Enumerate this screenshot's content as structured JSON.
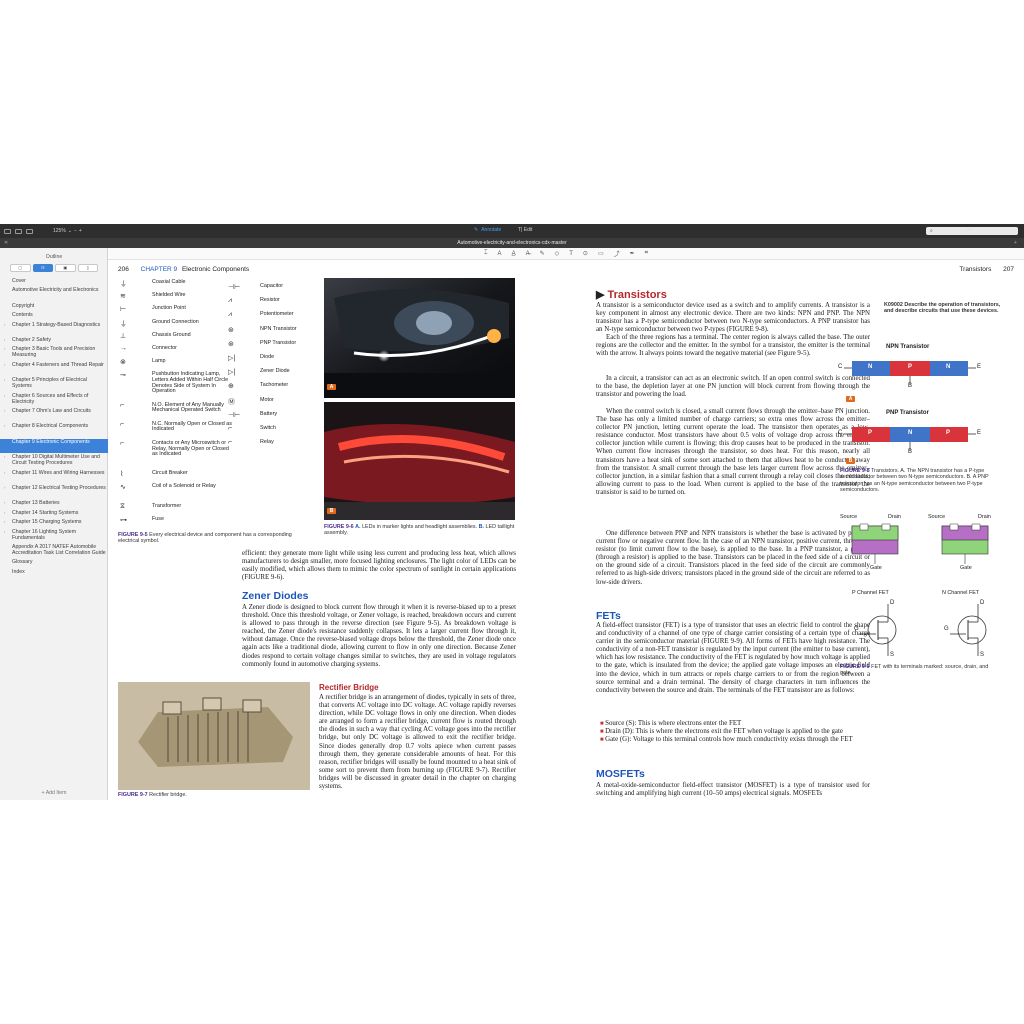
{
  "toolbar": {
    "zoom": "125%",
    "annotate": "Annotate",
    "edit": "Edit",
    "zoom_chevron": "⌄",
    "minus": "−",
    "plus": "+"
  },
  "title": "Automotive-electricity-and-electronics-cdx-master",
  "sidebar": {
    "title": "Outline",
    "toc": [
      {
        "label": "Cover",
        "caret": false,
        "sel": false
      },
      {
        "label": "Automotive Electricity and Electronics",
        "caret": false,
        "sel": false
      },
      {
        "label": "Copyright",
        "caret": false,
        "sel": false
      },
      {
        "label": "Contents",
        "caret": false,
        "sel": false
      },
      {
        "label": "Chapter 1 Strategy-Based Diagnostics",
        "caret": true,
        "sel": false
      },
      {
        "label": "Chapter 2 Safety",
        "caret": true,
        "sel": false
      },
      {
        "label": "Chapter 3 Basic Tools and Precision Measuring",
        "caret": true,
        "sel": false
      },
      {
        "label": "Chapter 4 Fasteners and Thread Repair",
        "caret": true,
        "sel": false
      },
      {
        "label": "Chapter 5 Principles of Electrical Systems",
        "caret": true,
        "sel": false
      },
      {
        "label": "Chapter 6 Sources and Effects of Electricity",
        "caret": true,
        "sel": false
      },
      {
        "label": "Chapter 7 Ohm's Law and Circuits",
        "caret": true,
        "sel": false
      },
      {
        "label": "Chapter 8 Electrical Components",
        "caret": true,
        "sel": false
      },
      {
        "label": "Chapter 9 Electronic Components",
        "caret": true,
        "sel": true
      },
      {
        "label": "Chapter 10 Digital Multimeter Use and Circuit Testing Procedures",
        "caret": true,
        "sel": false
      },
      {
        "label": "Chapter 11 Wires and Wiring Harnesses",
        "caret": true,
        "sel": false
      },
      {
        "label": "Chapter 12 Electrical Testing Procedures",
        "caret": true,
        "sel": false
      },
      {
        "label": "Chapter 13 Batteries",
        "caret": true,
        "sel": false
      },
      {
        "label": "Chapter 14 Starting Systems",
        "caret": true,
        "sel": false
      },
      {
        "label": "Chapter 15 Charging Systems",
        "caret": true,
        "sel": false
      },
      {
        "label": "Chapter 16 Lighting System Fundamentals",
        "caret": true,
        "sel": false
      },
      {
        "label": "Appendix A 2017 NATEF Automobile Accreditation Task List Correlation Guide",
        "caret": false,
        "sel": false
      },
      {
        "label": "Glossary",
        "caret": false,
        "sel": false
      },
      {
        "label": "Index",
        "caret": false,
        "sel": false
      }
    ],
    "add_item": "+ Add Item"
  },
  "page206": {
    "number": "206",
    "chapter": "CHAPTER 9",
    "chapter_title": "Electronic Components",
    "symbols_left": [
      {
        "icon": "⏚",
        "label": "Coaxial Cable"
      },
      {
        "icon": "≋",
        "label": "Shielded Wire"
      },
      {
        "icon": "⊢",
        "label": "Junction Point"
      },
      {
        "icon": "⏚",
        "label": "Ground Connection"
      },
      {
        "icon": "⊥",
        "label": "Chassis Ground"
      },
      {
        "icon": "→",
        "label": "Connector"
      },
      {
        "icon": "⊗",
        "label": "Lamp"
      },
      {
        "icon": "⊸",
        "label": "Pushbutton Indicating Lamp, Letters Added Within Half Circle Denotes Side of System In Operation"
      },
      {
        "icon": "⌐",
        "label": "N.O. Element of Any Manually Mechanical Operated Switch"
      },
      {
        "icon": "⌐",
        "label": "N.C. Normally Open or Closed as Indicated"
      },
      {
        "icon": "⌐",
        "label": "Contacts or Any Microswitch or Relay, Normally Open or Closed as Indicated"
      },
      {
        "icon": "⌇",
        "label": "Circuit Breaker"
      },
      {
        "icon": "∿",
        "label": "Coil of a Solenoid or Relay"
      },
      {
        "icon": "⧖",
        "label": "Transformer"
      },
      {
        "icon": "⊶",
        "label": "Fuse"
      }
    ],
    "symbols_right": [
      {
        "icon": "⊣⊢",
        "label": "Capacitor"
      },
      {
        "icon": "⩘",
        "label": "Resistor"
      },
      {
        "icon": "⩘",
        "label": "Potentiometer"
      },
      {
        "icon": "⊛",
        "label": "NPN Transistor"
      },
      {
        "icon": "⊛",
        "label": "PNP Transistor"
      },
      {
        "icon": "▷|",
        "label": "Diode"
      },
      {
        "icon": "▷|",
        "label": "Zener Diode"
      },
      {
        "icon": "⊕",
        "label": "Tachometer"
      },
      {
        "icon": "Ⓜ",
        "label": "Motor"
      },
      {
        "icon": "⊣⊢",
        "label": "Battery"
      },
      {
        "icon": "⌐",
        "label": "Switch"
      },
      {
        "icon": "⌐",
        "label": "Relay"
      }
    ],
    "fig95_label": "FIGURE 9-5",
    "fig95_caption": "Every electrical device and component has a corresponding electrical symbol.",
    "fig96_label": "FIGURE 9-6",
    "fig96_caption_a": "A.",
    "fig96_caption_a_text": "LEDs in marker lights and headlight assemblies.",
    "fig96_caption_b": "B.",
    "fig96_caption_b_text": "LED taillight assembly.",
    "badge_a": "A",
    "badge_b": "B",
    "para_efficient": "efficient: they generate more light while using less current and producing less heat, which allows manufacturers to design smaller, more focused lighting enclosures. The light color of LEDs can be easily modified, which allows them to mimic the color spectrum of sunlight in certain applications (FIGURE 9-6).",
    "zener_heading": "Zener Diodes",
    "zener_text": "A Zener diode is designed to block current flow through it when it is reverse-biased up to a preset threshold. Once this threshold voltage, or Zener voltage, is reached, breakdown occurs and current is allowed to pass through in the reverse direction (see Figure 9-5). As breakdown voltage is reached, the Zener diode's resistance suddenly collapses. It lets a larger current flow through it, without damage. Once the reverse-biased voltage drops below the threshold, the Zener diode once again acts like a traditional diode, allowing current to flow in only one direction. Because Zener diodes respond to certain voltage changes similar to switches, they are used in voltage regulators commonly found in automotive charging systems.",
    "rect_heading": "Rectifier Bridge",
    "rect_text": "A rectifier bridge is an arrangement of diodes, typically in sets of three, that converts AC voltage into DC voltage. AC voltage rapidly reverses direction, while DC voltage flows in only one direction. When diodes are arranged to form a rectifier bridge, current flow is routed through the diodes in such a way that cycling AC voltage goes into the rectifier bridge, but only DC voltage is allowed to exit the rectifier bridge. Since diodes generally drop 0.7 volts apiece when current passes through them, they generate considerable amounts of heat. For this reason, rectifier bridges will usually be found mounted to a heat sink of some sort to prevent them from burning up (FIGURE 9-7). Rectifier bridges will be discussed in greater detail in the chapter on charging systems.",
    "fig97_label": "FIGURE 9-7",
    "fig97_caption": "Rectifier bridge."
  },
  "page207": {
    "number": "207",
    "running_title": "Transistors",
    "transistors_heading": "Transistors",
    "objective_code": "K09002",
    "objective_text": "Describe the operation of transistors, and describe circuits that use these devices.",
    "p1": "A transistor is a semiconductor device used as a switch and to amplify currents. A transistor is a key component in almost any electronic device. There are two kinds: NPN and PNP. The NPN transistor has a P-type semiconductor between two N-type semiconductors. A PNP transistor has an N-type semiconductor between two P-types (FIGURE 9-8).",
    "p2": "Each of the three regions has a terminal. The center region is always called the base. The outer regions are the collector and the emitter. In the symbol for a transistor, the emitter is the terminal with the arrow. It always points toward the negative material (see Figure 9-5).",
    "p3": "In a circuit, a transistor can act as an electronic switch. If an open control switch is connected to the base, the depletion layer at one PN junction will block current from flowing through the transistor and powering the load.",
    "p4": "When the control switch is closed, a small current flows through the emitter–base PN junction. The base has only a limited number of charge carriers; so extra ones flow across the emitter–collector PN junction, letting current operate the load. The transistor then operates as a low-resistance conductor. Most transistors have about 0.5 volts of voltage drop across the emitter–collector junction while current is flowing; this drop causes heat to be produced in the transistor. When current flow increases through the transistor, so does heat. For this reason, nearly all transistors have a heat sink of some sort attached to them that allows heat to be conducted away from the transistor. A small current through the base lets larger current flow across the emitter–collector junction, in a similar fashion that a small current through a relay coil closes the contacts, allowing current to pass to the load. When current is applied to the base of the transistor, the transistor is said to be turned on.",
    "p5": "One difference between PNP and NPN transistors is whether the base is activated by positive current flow or negative current flow. In the case of an NPN transistor, positive current, through a resistor (to limit current flow to the base), is applied to the base. In a PNP transistor, a ground (through a resistor) is applied to the base. Transistors can be placed in the feed side of a circuit or on the ground side of a circuit. Transistors placed in the feed side of the circuit are commonly referred to as high-side drivers; transistors placed in the ground side of the circuit are referred to as low-side drivers.",
    "fets_heading": "FETs",
    "fets_text": "A field-effect transistor (FET) is a type of transistor that uses an electric field to control the shape and conductivity of a channel of one type of charge carrier consisting of a certain type of charge carrier in the semiconductor material (FIGURE 9-9). All forms of FETs have high resistance. The conductivity of a non-FET transistor is regulated by the input current (the emitter to base current), which has low resistance. The conductivity of the FET is regulated by how much voltage is applied to the gate, which is insulated from the device; the applied gate voltage imposes an electric field into the device, which in turn attracts or repels charge carriers to or from the region between a source terminal and a drain terminal. The density of charge characters in turn influences the conductivity between the source and drain. The terminals of the FET transistor are as follows:",
    "bullets": [
      "Source (S): This is where electrons enter the FET",
      "Drain (D): This is where the electrons exit the FET when voltage is applied to the gate",
      "Gate (G): Voltage to this terminal controls how much conductivity exists through the FET"
    ],
    "mosfets_heading": "MOSFETs",
    "mosfets_text": "A metal-oxide-semiconductor field-effect transistor (MOSFET) is a type of transistor used for switching and amplifying high current (10–50 amps) electrical signals. MOSFETs",
    "npn_title": "NPN Transistor",
    "pnp_title": "PNP Transistor",
    "npn_layers": [
      "N",
      "P",
      "N"
    ],
    "pnp_layers": [
      "P",
      "N",
      "P"
    ],
    "terminal_c": "C",
    "terminal_e": "E",
    "terminal_b": "B",
    "badge_a": "A",
    "badge_b": "B",
    "fig98_label": "FIGURE 9-8",
    "fig98_caption": "Transistors. A. The NPN transistor has a P-type semiconductor between two N-type semiconductors. B. A PNP transistor has an N-type semiconductor between two P-type semiconductors.",
    "fet_source": "Source",
    "fet_drain": "Drain",
    "fet_gate": "Gate",
    "fet_p_label": "P Channel FET",
    "fet_n_label": "N Channel FET",
    "fet_d": "D",
    "fet_g": "G",
    "fet_s": "S",
    "fig99_label": "FIGURE 9-9",
    "fig99_caption": "FET with its terminals marked: source, drain, and gate."
  },
  "colors": {
    "accent": "#3b82d8",
    "heading_blue": "#1d56b8",
    "heading_red": "#b5282b",
    "n_type": "#3f74c9",
    "p_type": "#d9343c",
    "badge": "#e06a1b"
  }
}
